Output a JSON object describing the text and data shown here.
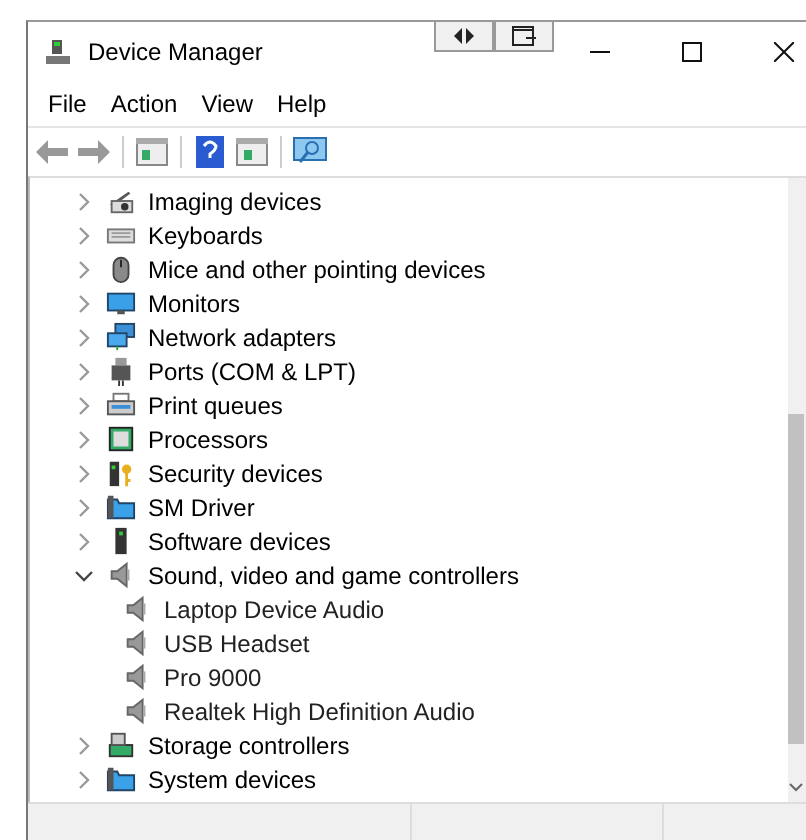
{
  "window": {
    "title": "Device Manager"
  },
  "menu": [
    "File",
    "Action",
    "View",
    "Help"
  ],
  "tree": [
    {
      "label": "Imaging devices",
      "kind": "camera",
      "expanded": false
    },
    {
      "label": "Keyboards",
      "kind": "keyboard",
      "expanded": false
    },
    {
      "label": "Mice and other pointing devices",
      "kind": "mouse",
      "expanded": false
    },
    {
      "label": "Monitors",
      "kind": "monitor",
      "expanded": false
    },
    {
      "label": "Network adapters",
      "kind": "network",
      "expanded": false
    },
    {
      "label": "Ports (COM & LPT)",
      "kind": "port",
      "expanded": false
    },
    {
      "label": "Print queues",
      "kind": "printer",
      "expanded": false
    },
    {
      "label": "Processors",
      "kind": "chip",
      "expanded": false
    },
    {
      "label": "Security devices",
      "kind": "security",
      "expanded": false
    },
    {
      "label": "SM Driver",
      "kind": "folder",
      "expanded": false
    },
    {
      "label": "Software devices",
      "kind": "tower",
      "expanded": false
    },
    {
      "label": "Sound, video and game controllers",
      "kind": "speaker",
      "expanded": true,
      "children": [
        {
          "label": "Laptop Device Audio",
          "kind": "speaker"
        },
        {
          "label": "USB Headset",
          "kind": "speaker"
        },
        {
          "label": "Pro 9000",
          "kind": "speaker"
        },
        {
          "label": "Realtek High Definition Audio",
          "kind": "speaker"
        }
      ]
    },
    {
      "label": "Storage controllers",
      "kind": "storage",
      "expanded": false
    },
    {
      "label": "System devices",
      "kind": "folder",
      "expanded": false
    }
  ]
}
